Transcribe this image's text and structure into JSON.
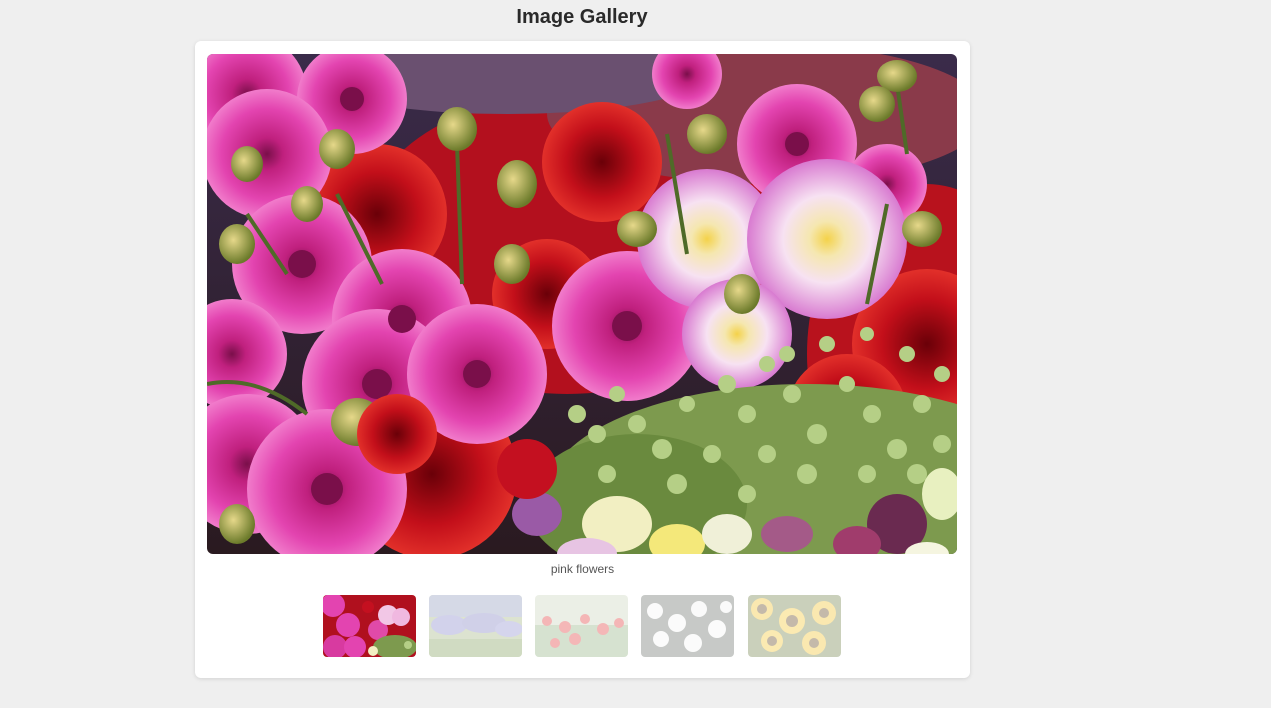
{
  "header": {
    "title": "Image Gallery"
  },
  "gallery": {
    "caption": "pink flowers",
    "selected_index": 0,
    "thumbnails": [
      {
        "label": "pink flowers",
        "active": true
      },
      {
        "label": "lavender field",
        "active": false
      },
      {
        "label": "red poppies",
        "active": false
      },
      {
        "label": "white daisies",
        "active": false
      },
      {
        "label": "sunflowers",
        "active": false
      }
    ]
  },
  "colors": {
    "background": "#efefef",
    "card": "#ffffff",
    "title_text": "#2a2a2a",
    "caption_text": "#555555"
  }
}
